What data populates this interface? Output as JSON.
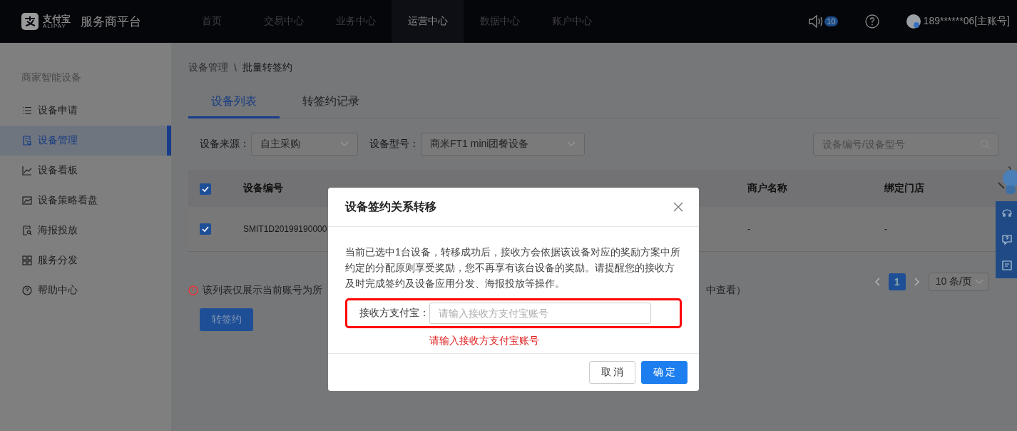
{
  "header": {
    "logo_text": "支付宝",
    "logo_subtext": "ALIPAY",
    "platform": "服务商平台",
    "nav": [
      {
        "label": "首页",
        "selected": false
      },
      {
        "label": "交易中心",
        "selected": false
      },
      {
        "label": "业务中心",
        "selected": false
      },
      {
        "label": "运营中心",
        "selected": true
      },
      {
        "label": "数据中心",
        "selected": false
      },
      {
        "label": "账户中心",
        "selected": false
      }
    ],
    "notification_count": "10",
    "account": "189******06[主账号]"
  },
  "sidebar": {
    "title": "商家智能设备",
    "items": [
      {
        "label": "设备申请",
        "kind": "list",
        "selected": false
      },
      {
        "label": "设备管理",
        "kind": "doc",
        "selected": true
      },
      {
        "label": "设备看板",
        "kind": "line",
        "selected": false
      },
      {
        "label": "设备策略看盘",
        "kind": "area",
        "selected": false
      },
      {
        "label": "海报投放",
        "kind": "search-doc",
        "selected": false
      },
      {
        "label": "服务分发",
        "kind": "grid",
        "selected": false
      },
      {
        "label": "帮助中心",
        "kind": "help",
        "selected": false
      }
    ]
  },
  "breadcrumb": {
    "items": [
      "设备管理",
      "批量转签约"
    ],
    "separator": "\\"
  },
  "tabs": [
    {
      "label": "设备列表",
      "selected": true
    },
    {
      "label": "转签约记录",
      "selected": false
    }
  ],
  "filters": [
    {
      "label": "设备来源：",
      "value": "自主采购"
    },
    {
      "label": "设备型号：",
      "value": "商米FT1 mini团餐设备"
    }
  ],
  "search": {
    "placeholder": "设备编号/设备型号"
  },
  "table": {
    "header_checked": true,
    "columns": [
      "设备编号",
      "商户名称",
      "绑定门店"
    ],
    "rows": [
      {
        "checked": true,
        "device_no": "SMIT1D20199190000",
        "merchant_name": "-",
        "store": "-"
      }
    ]
  },
  "notice": {
    "text_start": "该列表仅展示当前账号为所",
    "text_end": "中查看）"
  },
  "pagination": {
    "pages": [
      {
        "label": "1",
        "selected": true
      }
    ],
    "page_size": "10 条/页"
  },
  "primary_action": "转签约",
  "modal": {
    "title": "设备签约关系转移",
    "message": "当前已选中1台设备，转移成功后，接收方会依据该设备对应的奖励方案中所约定的分配原则享受奖励，您不再享有该台设备的奖励。请提醒您的接收方及时完成签约及设备应用分发、海报投放等操作。",
    "field": {
      "label": "接收方支付宝：",
      "placeholder": "请输入接收方支付宝账号",
      "error": "请输入接收方支付宝账号",
      "highlighted": true
    },
    "buttons": [
      {
        "label": "取 消",
        "kind": "default"
      },
      {
        "label": "确 定",
        "kind": "primary"
      }
    ]
  }
}
